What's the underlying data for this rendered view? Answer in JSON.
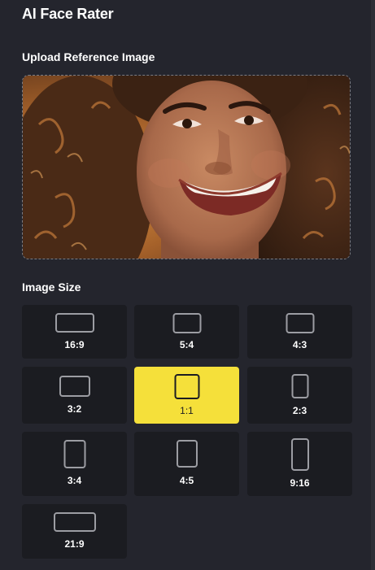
{
  "app": {
    "title": "AI Face Rater"
  },
  "upload": {
    "label": "Upload Reference Image",
    "image_alt": "Smiling woman with curly hair (uploaded reference photo)"
  },
  "image_size": {
    "label": "Image Size",
    "selected": "1:1",
    "options": [
      {
        "ratio": "16:9"
      },
      {
        "ratio": "5:4"
      },
      {
        "ratio": "4:3"
      },
      {
        "ratio": "3:2"
      },
      {
        "ratio": "1:1"
      },
      {
        "ratio": "2:3"
      },
      {
        "ratio": "3:4"
      },
      {
        "ratio": "4:5"
      },
      {
        "ratio": "9:16"
      },
      {
        "ratio": "21:9"
      }
    ]
  },
  "colors": {
    "background": "#24252d",
    "tile": "#1b1c21",
    "accent": "#f5e03a",
    "shape_outline": "#9c9da3"
  }
}
